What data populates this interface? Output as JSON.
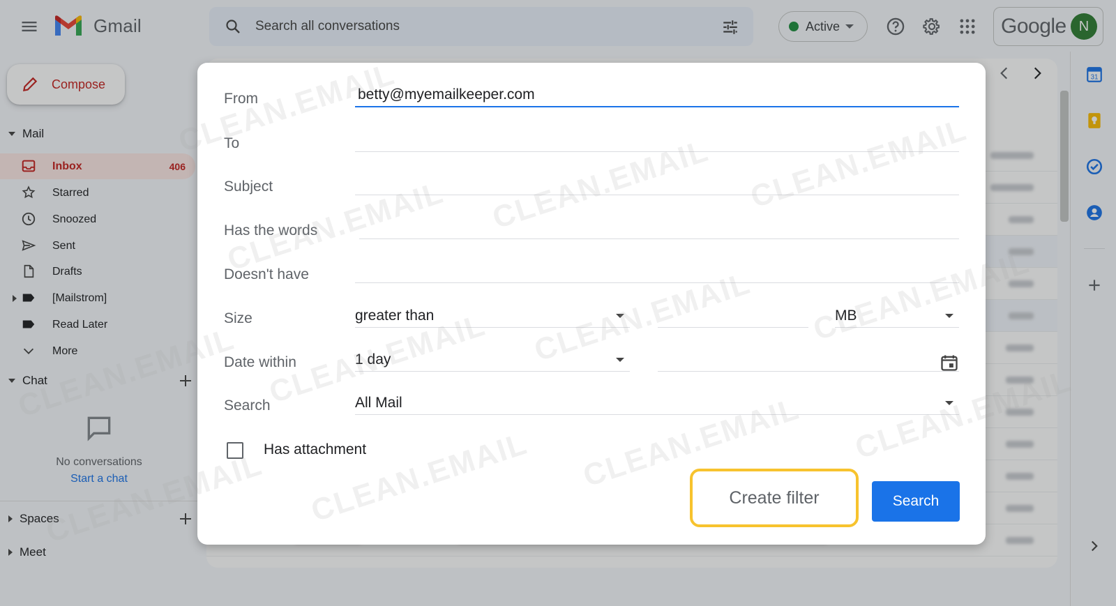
{
  "app": {
    "name": "Gmail"
  },
  "search": {
    "placeholder": "Search all conversations"
  },
  "status": {
    "label": "Active"
  },
  "account": {
    "brand": "Google",
    "avatar_initial": "N"
  },
  "sidebar": {
    "compose_label": "Compose",
    "mail_heading": "Mail",
    "items": [
      {
        "label": "Inbox",
        "count": "406",
        "icon": "inbox-icon",
        "active": true
      },
      {
        "label": "Starred",
        "icon": "star-icon"
      },
      {
        "label": "Snoozed",
        "icon": "clock-icon"
      },
      {
        "label": "Sent",
        "icon": "send-icon"
      },
      {
        "label": "Drafts",
        "icon": "file-icon"
      },
      {
        "label": "[Mailstrom]",
        "icon": "label-icon"
      },
      {
        "label": "Read Later",
        "icon": "label-icon"
      },
      {
        "label": "More",
        "icon": "chevron-down-icon"
      }
    ],
    "chat_heading": "Chat",
    "chat_empty": "No conversations",
    "chat_start": "Start a chat",
    "spaces_heading": "Spaces",
    "meet_heading": "Meet"
  },
  "filter_dialog": {
    "from_label": "From",
    "from_value": "betty@myemailkeeper.com",
    "to_label": "To",
    "subject_label": "Subject",
    "has_words_label": "Has the words",
    "doesnt_have_label": "Doesn't have",
    "size_label": "Size",
    "size_operator": "greater than",
    "size_unit": "MB",
    "date_label": "Date within",
    "date_value": "1 day",
    "search_label": "Search",
    "search_scope": "All Mail",
    "attachment_label": "Has attachment",
    "create_filter": "Create filter",
    "search_button": "Search"
  },
  "watermark": "CLEAN.EMAIL",
  "colors": {
    "accent_red": "#c5221f",
    "primary_blue": "#1a73e8",
    "highlight_yellow": "#f7c32e",
    "active_green": "#1e8e3e"
  }
}
